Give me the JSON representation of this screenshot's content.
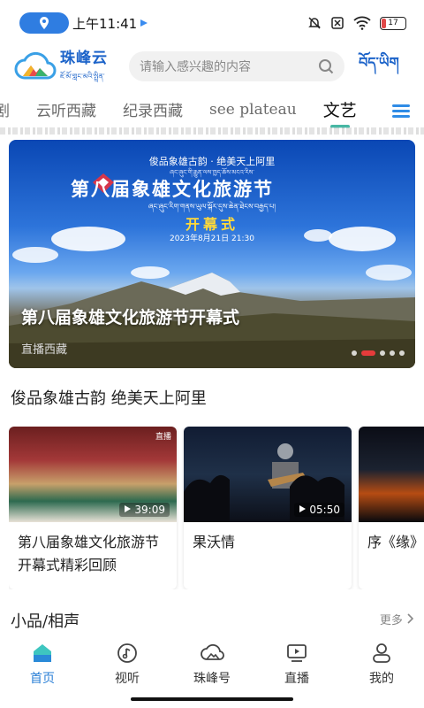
{
  "status_bar": {
    "time": "上午11:41",
    "battery": "17"
  },
  "header": {
    "app_name": "珠峰云",
    "app_name_tibetan": "ཇོ་མོ་གླང་མའི་སྤྲིན་",
    "search_placeholder": "请输入感兴趣的内容",
    "tibetan_button": "བོད་ཡིག"
  },
  "tabs": [
    "剧",
    "云听西藏",
    "纪录西藏",
    "see plateau",
    "文艺"
  ],
  "active_tab": "文艺",
  "banner": {
    "subtitle": "俊品象雄古韵 · 绝美天上阿里",
    "subtitle_tibetan": "ཞང་ཞུང་གི་རྒྱུན་ལས་ཁྱད་ཆོས་མངའ་རིས་",
    "title": "第八届象雄文化旅游节",
    "title_tibetan": "ཞང་ཞུང་རིག་གནས་ཡུལ་སྐོར་དུས་ཆེན་ཐེངས་བརྒྱད་པ།",
    "opening": "开幕式",
    "date": "2023年8月21日 21:30",
    "caption": "第八届象雄文化旅游节开幕式",
    "source": "直播西藏"
  },
  "section_1": {
    "title": "俊品象雄古韵 绝美天上阿里",
    "cards": [
      {
        "title": "第八届象雄文化旅游节开幕式精彩回顾",
        "duration": "39:09",
        "tag": "直播"
      },
      {
        "title": "果沃情",
        "duration": "05:50"
      },
      {
        "title": "序《缘》"
      }
    ]
  },
  "section_2": {
    "title": "小品/相声",
    "more": "更多"
  },
  "bottom_nav": [
    {
      "label": "首页",
      "icon": "home-icon",
      "active": true
    },
    {
      "label": "视听",
      "icon": "music-note-icon"
    },
    {
      "label": "珠峰号",
      "icon": "cloud-icon"
    },
    {
      "label": "直播",
      "icon": "live-tv-icon"
    },
    {
      "label": "我的",
      "icon": "person-icon"
    }
  ],
  "colors": {
    "brand_blue": "#1c63c9",
    "tab_accent": "#48b7a4",
    "banner_dot_active": "#e53b3b",
    "nav_active": "#2a7fd6"
  }
}
